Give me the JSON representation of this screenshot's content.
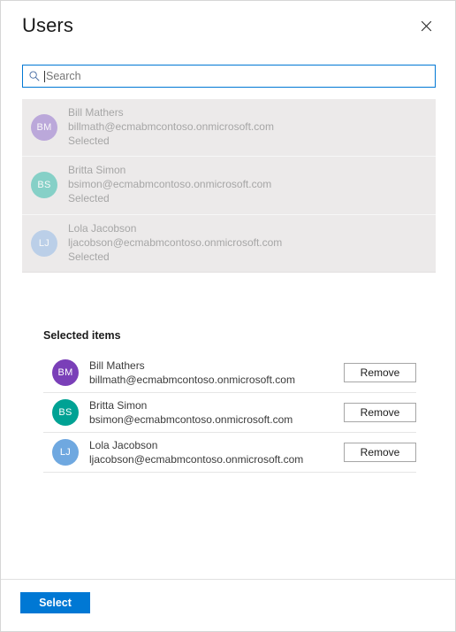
{
  "header": {
    "title": "Users",
    "close_icon": "close-icon"
  },
  "search": {
    "icon": "search-icon",
    "placeholder": "Search",
    "value": ""
  },
  "results": {
    "items": [
      {
        "initials": "BM",
        "name": "Bill Mathers",
        "email": "billmath@ecmabmcontoso.onmicrosoft.com",
        "state": "Selected",
        "color": "#a98fd4"
      },
      {
        "initials": "BS",
        "name": "Britta Simon",
        "email": "bsimon@ecmabmcontoso.onmicrosoft.com",
        "state": "Selected",
        "color": "#5fc7ba"
      },
      {
        "initials": "LJ",
        "name": "Lola Jacobson",
        "email": "ljacobson@ecmabmcontoso.onmicrosoft.com",
        "state": "Selected",
        "color": "#a9c6e8"
      }
    ]
  },
  "selected": {
    "heading": "Selected items",
    "items": [
      {
        "initials": "BM",
        "name": "Bill Mathers",
        "email": "billmath@ecmabmcontoso.onmicrosoft.com",
        "remove_label": "Remove",
        "color": "#7a3fb8"
      },
      {
        "initials": "BS",
        "name": "Britta Simon",
        "email": "bsimon@ecmabmcontoso.onmicrosoft.com",
        "remove_label": "Remove",
        "color": "#00a294"
      },
      {
        "initials": "LJ",
        "name": "Lola Jacobson",
        "email": "ljacobson@ecmabmcontoso.onmicrosoft.com",
        "remove_label": "Remove",
        "color": "#6fa8e0"
      }
    ]
  },
  "footer": {
    "select_label": "Select"
  },
  "colors": {
    "accent": "#0078d4",
    "list_background": "#eceaea",
    "disabled_text": "#a6a6a6"
  }
}
